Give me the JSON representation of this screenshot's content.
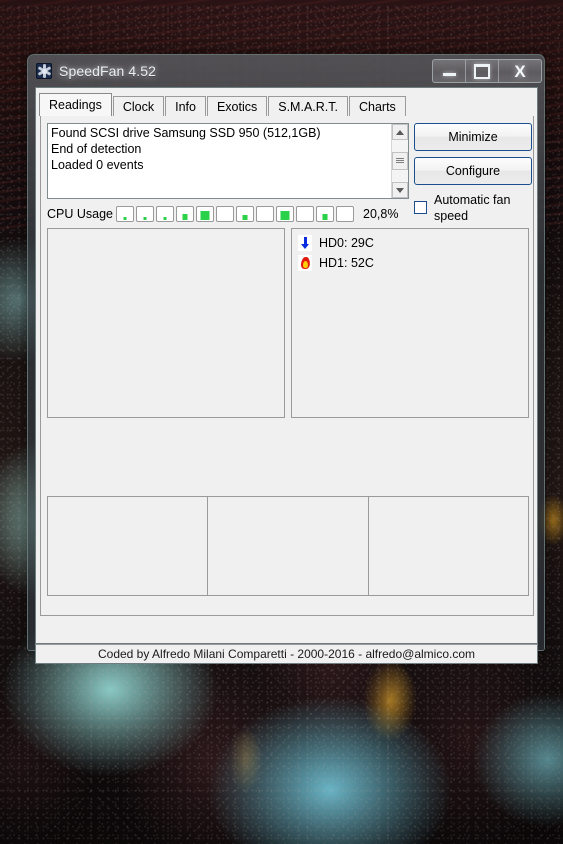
{
  "desktop": {
    "wallpaper_description": "underwater aquarium photo with dark fish and cyan water"
  },
  "window": {
    "title": "SpeedFan 4.52",
    "icon": "fan-icon",
    "caption": {
      "minimize": "minimize-icon",
      "maximize": "maximize-icon",
      "close": "×",
      "close_label": "X"
    }
  },
  "tabs": [
    {
      "label": "Readings",
      "active": true
    },
    {
      "label": "Clock",
      "active": false
    },
    {
      "label": "Info",
      "active": false
    },
    {
      "label": "Exotics",
      "active": false
    },
    {
      "label": "S.M.A.R.T.",
      "active": false
    },
    {
      "label": "Charts",
      "active": false
    }
  ],
  "log": {
    "lines": [
      "Found SCSI drive Samsung SSD 950 (512,1GB)",
      "End of detection",
      "Loaded 0 events"
    ],
    "scrollbar": {
      "up": "scroll-up-icon",
      "down": "scroll-down-icon"
    }
  },
  "buttons": {
    "minimize": "Minimize",
    "configure": "Configure"
  },
  "automatic_fan_speed": {
    "label": "Automatic fan speed",
    "checked": false
  },
  "cpu_usage": {
    "label": "CPU Usage",
    "percent_text": "20,8%",
    "percent_value": 20.8,
    "cell_count": 12,
    "cell_levels": [
      25,
      25,
      22,
      45,
      72,
      0,
      40,
      0,
      70,
      0,
      48,
      0
    ],
    "bar_color": "#2ad24a"
  },
  "temperatures": [
    {
      "icon": "cool-arrow-icon",
      "label": "HD0:",
      "value": "29C",
      "text": "HD0: 29C"
    },
    {
      "icon": "flame-icon",
      "label": "HD1:",
      "value": "52C",
      "text": "HD1: 52C"
    }
  ],
  "fans": [],
  "bottom_panels": [
    "",
    "",
    ""
  ],
  "statusbar": {
    "text": "Coded by Alfredo Milani Comparetti - 2000-2016 - alfredo@almico.com"
  },
  "colors": {
    "accent_border": "#1b4e8c",
    "face": "#f0f0f0",
    "bar_green": "#2ad24a",
    "cool_blue": "#0a2ce0",
    "hot_red": "#e01b0d"
  }
}
